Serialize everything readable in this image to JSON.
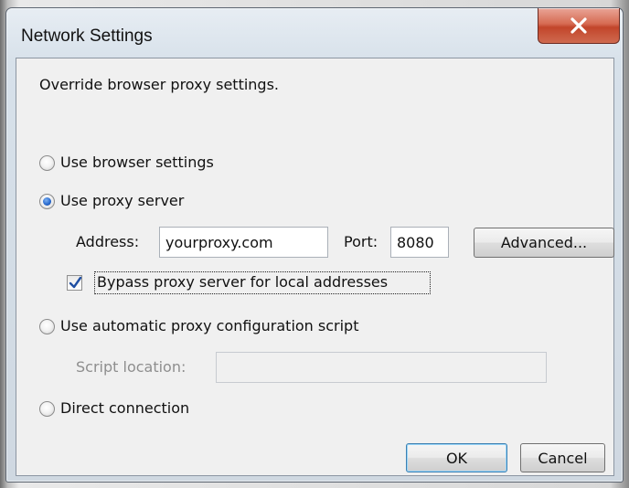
{
  "dialog": {
    "title": "Network Settings",
    "description": "Override browser proxy settings."
  },
  "options": {
    "browser_settings": "Use browser settings",
    "proxy_server": "Use proxy server",
    "auto_config": "Use automatic proxy configuration script",
    "direct": "Direct connection",
    "selected": "proxy_server"
  },
  "proxy": {
    "address_label": "Address:",
    "address_value": "yourproxy.com",
    "port_label": "Port:",
    "port_value": "8080",
    "advanced_label": "Advanced...",
    "bypass_label": "Bypass proxy server for local addresses",
    "bypass_checked": true
  },
  "auto_config": {
    "script_label": "Script location:",
    "script_value": ""
  },
  "buttons": {
    "ok": "OK",
    "cancel": "Cancel"
  },
  "colors": {
    "close_button": "#c2452b",
    "radio_selected": "#2a6cd1",
    "checkmark": "#1f4fa3"
  }
}
